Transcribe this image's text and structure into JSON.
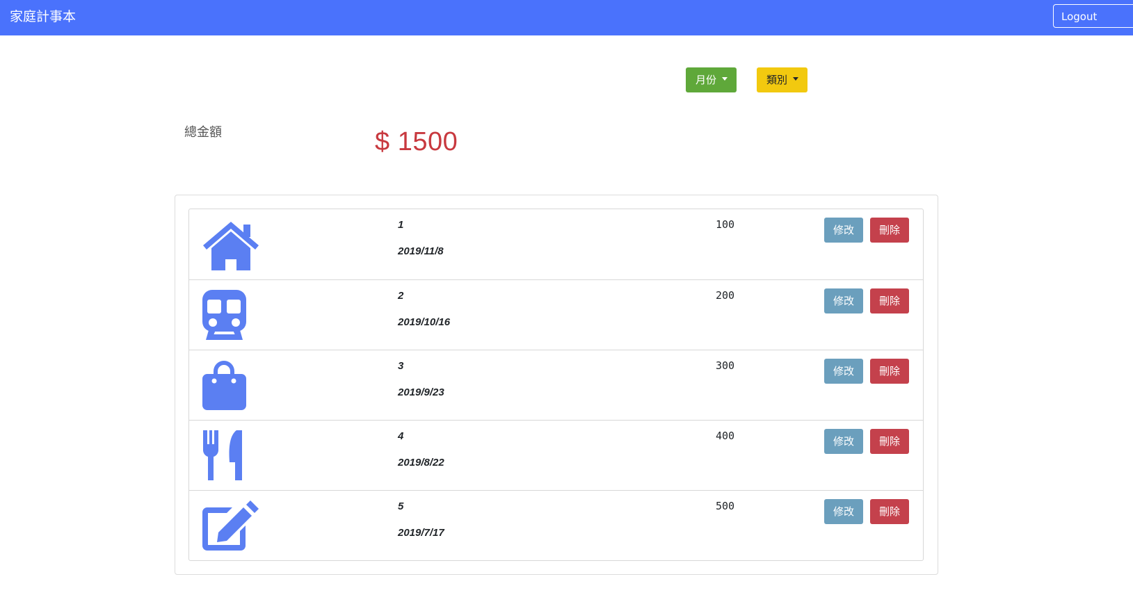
{
  "navbar": {
    "brand": "家庭計事本",
    "logout_label": "Logout"
  },
  "filters": {
    "month_label": "月份",
    "category_label": "類別"
  },
  "summary": {
    "total_label": "總金額",
    "total_amount": "$ 1500"
  },
  "colors": {
    "navbar": "#4a72fc",
    "icon": "#5b7ff2",
    "amount": "#c8393f",
    "month_button": "#5fa83a",
    "category_button": "#f2c90f",
    "edit_button": "#6b9fbd",
    "delete_button": "#c4414c"
  },
  "records": [
    {
      "icon": "home-icon",
      "name": "1",
      "date": "2019/11/8",
      "amount": "100",
      "edit_label": "修改",
      "delete_label": "刪除"
    },
    {
      "icon": "train-icon",
      "name": "2",
      "date": "2019/10/16",
      "amount": "200",
      "edit_label": "修改",
      "delete_label": "刪除"
    },
    {
      "icon": "shopping-bag-icon",
      "name": "3",
      "date": "2019/9/23",
      "amount": "300",
      "edit_label": "修改",
      "delete_label": "刪除"
    },
    {
      "icon": "utensils-icon",
      "name": "4",
      "date": "2019/8/22",
      "amount": "400",
      "edit_label": "修改",
      "delete_label": "刪除"
    },
    {
      "icon": "edit-pen-icon",
      "name": "5",
      "date": "2019/7/17",
      "amount": "500",
      "edit_label": "修改",
      "delete_label": "刪除"
    }
  ]
}
